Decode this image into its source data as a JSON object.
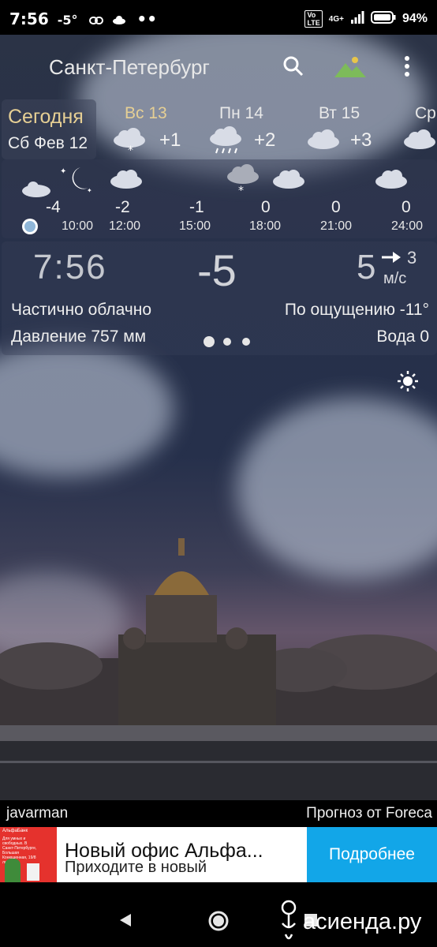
{
  "status_bar": {
    "time": "7:56",
    "temp": "-5°",
    "network": "4G+",
    "battery": "94%"
  },
  "header": {
    "city": "Санкт-Петербург"
  },
  "days": [
    {
      "label": "Сегодня",
      "date": "Сб Фев 12"
    },
    {
      "label": "Вс 13",
      "temp": "+1",
      "icon": "snow-cloud-icon"
    },
    {
      "label": "Пн 14",
      "temp": "+2",
      "icon": "rain-cloud-icon"
    },
    {
      "label": "Вт 15",
      "temp": "+3",
      "icon": "partly-cloudy-icon"
    },
    {
      "label": "Ср",
      "icon": "partly-cloudy-icon"
    }
  ],
  "hourly": [
    {
      "temp": "-4",
      "time": "10:00"
    },
    {
      "temp": "-2",
      "time": "12:00"
    },
    {
      "temp": "-1",
      "time": "15:00"
    },
    {
      "temp": "0",
      "time": "18:00"
    },
    {
      "temp": "0",
      "time": "21:00"
    },
    {
      "temp": "0",
      "time": "24:00"
    }
  ],
  "current": {
    "clock": "7:56",
    "temp": "-5",
    "wind_speed": "5",
    "wind_gust": "3",
    "wind_unit": "м/с",
    "condition": "Частично облачно",
    "feels_like": "По ощущению -11°",
    "pressure": "Давление 757 мм",
    "water": "Вода 0"
  },
  "footer": {
    "author": "javarman",
    "source": "Прогноз от Foreca"
  },
  "ad": {
    "title": "Новый офис Альфа...",
    "subtitle": "Приходите в новый",
    "button": "Подробнее",
    "thumb_brand": "АльфаБанк",
    "thumb_text": "Для умных и свободных. В Санкт-Петербурге, Большая Конюшенная, 19/8 литера А"
  },
  "watermark": "асиенда.ру",
  "colors": {
    "accent_gold": "#e6cf94",
    "ad_button": "#12a6e8",
    "ad_thumb": "#e5322d"
  }
}
